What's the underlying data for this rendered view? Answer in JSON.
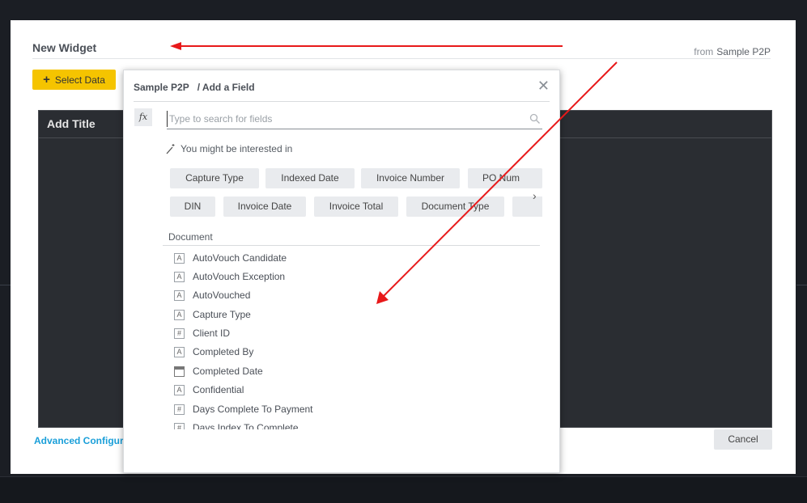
{
  "dialog": {
    "title": "New Widget",
    "from_label": "from",
    "source_name": "Sample P2P",
    "select_data_label": "Select Data",
    "preview_title": "Add Title",
    "advanced_link": "Advanced Configur",
    "cancel_label": "Cancel"
  },
  "panel": {
    "breadcrumb_source": "Sample P2P",
    "breadcrumb_page": "/ Add a Field",
    "close_icon": "close-icon",
    "fx_label": "fx",
    "search_placeholder": "Type to search for fields",
    "interest_label": "You might be interested in",
    "chips": [
      "Capture Type",
      "Indexed Date",
      "Invoice Number",
      "PO Num",
      "DIN",
      "Invoice Date",
      "Invoice Total",
      "Document Type"
    ],
    "section_label": "Document",
    "fields": [
      {
        "type_icon": "text-type-icon",
        "glyph": "A",
        "label": "AutoVouch Candidate"
      },
      {
        "type_icon": "text-type-icon",
        "glyph": "A",
        "label": "AutoVouch Exception"
      },
      {
        "type_icon": "text-type-icon",
        "glyph": "A",
        "label": "AutoVouched"
      },
      {
        "type_icon": "text-type-icon",
        "glyph": "A",
        "label": "Capture Type"
      },
      {
        "type_icon": "number-type-icon",
        "glyph": "#",
        "label": "Client ID"
      },
      {
        "type_icon": "text-type-icon",
        "glyph": "A",
        "label": "Completed By"
      },
      {
        "type_icon": "date-type-icon",
        "glyph": "",
        "label": "Completed Date"
      },
      {
        "type_icon": "text-type-icon",
        "glyph": "A",
        "label": "Confidential"
      },
      {
        "type_icon": "number-type-icon",
        "glyph": "#",
        "label": "Days Complete To Payment"
      },
      {
        "type_icon": "number-type-icon",
        "glyph": "#",
        "label": "Days Index To Complete"
      }
    ]
  },
  "colors": {
    "accent_yellow": "#f5c400",
    "link_blue": "#1a9fd9",
    "annotation_red": "#e8191a",
    "backdrop": "#1b1e24"
  }
}
